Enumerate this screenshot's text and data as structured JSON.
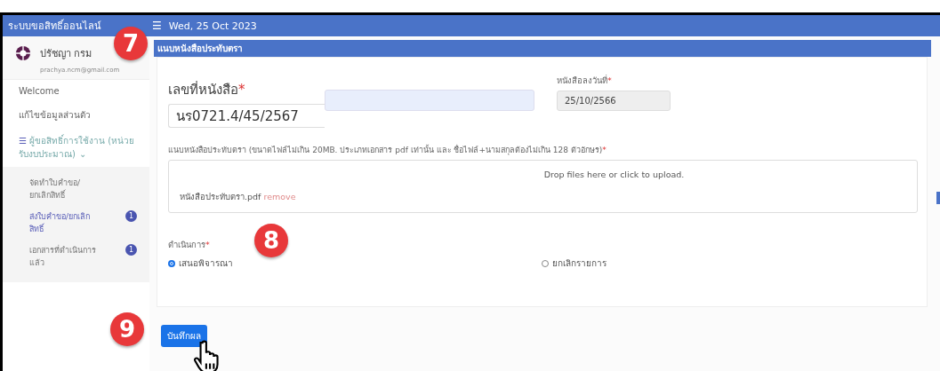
{
  "header": {
    "brand": "ระบบขอสิทธิ์ออนไลน์",
    "menu_icon": "☰",
    "date": "Wed, 25 Oct 2023"
  },
  "user": {
    "name": "ปรัชญา กรม",
    "email": "prachya.ncm@gmail.com"
  },
  "sidebar": {
    "items": [
      {
        "label": "Welcome",
        "selected": false
      },
      {
        "label": "แก้ไขข้อมูลส่วนตัว",
        "selected": false
      },
      {
        "label": "ผู้ขอสิทธิ์การใช้งาน (หน่วยรับงบประมาณ)",
        "icon": "☰",
        "chevron": "⌄",
        "selected": false,
        "expanded": true,
        "children": [
          {
            "label": "จัดทำใบคำขอ/ยกเลิกสิทธิ์",
            "selected": false
          },
          {
            "label": "ส่งใบคำขอ/ยกเลิกสิทธิ์",
            "selected": true,
            "badge": "1"
          },
          {
            "label": "เอกสารที่ดำเนินการแล้ว",
            "selected": false,
            "badge": "1"
          }
        ]
      }
    ]
  },
  "section_title": "แนบหนังสือประทับตรา",
  "form": {
    "letter_no": {
      "label": "เลขที่หนังสือ",
      "required_mark": "*",
      "value": "นร0721.4/45/2567"
    },
    "letter_date": {
      "label": "หนังสือลงวันที่",
      "required_mark": "*",
      "value": "25/10/2566",
      "disabled": true
    },
    "upload": {
      "label": "แนบหนังสือประทับตรา (ขนาดไฟล์ไม่เกิน 20MB. ประเภทเอกสาร pdf เท่านั้น และ ชื่อไฟล์+นามสกุลต้องไม่เกิน 128 ตัวอักษร)",
      "required_mark": "*",
      "prompt": "Drop files here or click to upload.",
      "file": "หนังสือประทับตรา.pdf",
      "remove": "remove"
    },
    "action": {
      "label": "ดำเนินการ",
      "required_mark": "*",
      "options": [
        {
          "label": "เสนอพิจารณา",
          "selected": true
        },
        {
          "label": "ยกเลิกรายการ",
          "selected": false
        }
      ]
    }
  },
  "save_button": "บันทึกผล",
  "annotations": [
    "7",
    "8",
    "9"
  ]
}
